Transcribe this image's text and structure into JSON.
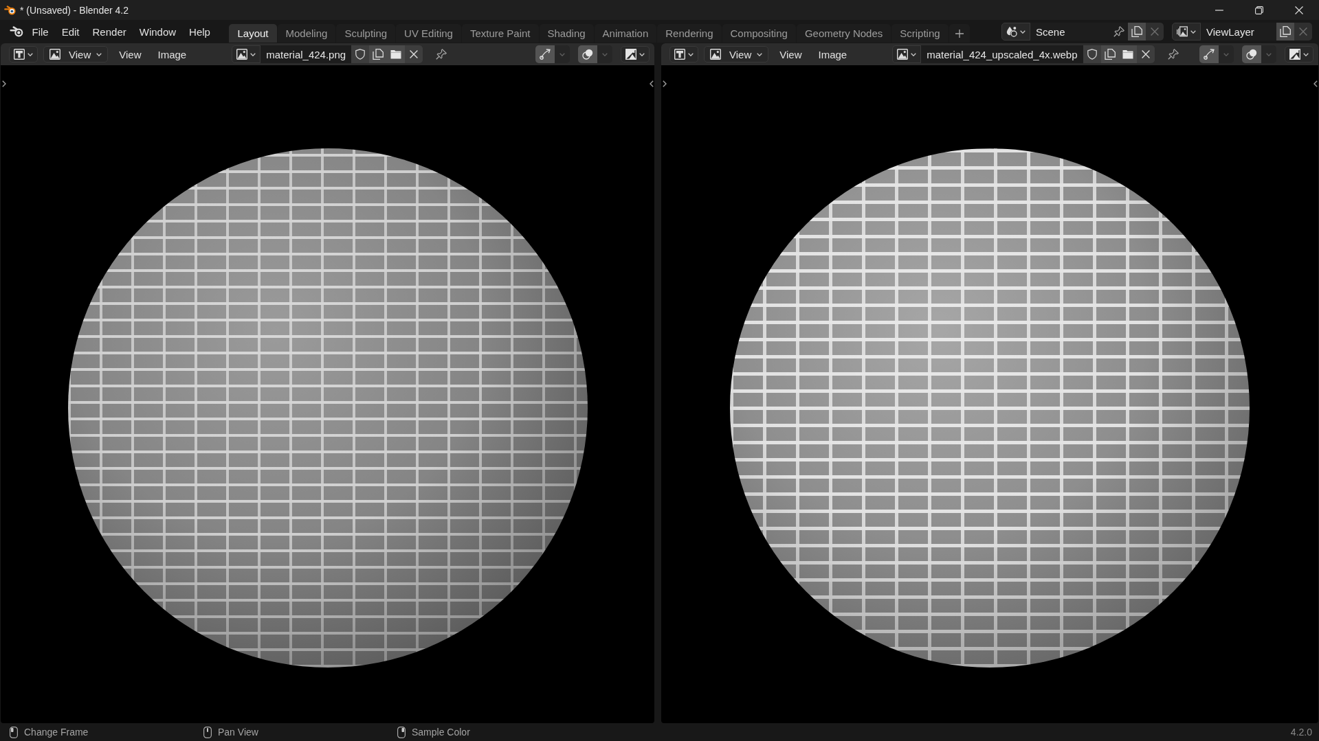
{
  "window": {
    "title": "* (Unsaved) - Blender 4.2"
  },
  "menu": [
    "File",
    "Edit",
    "Render",
    "Window",
    "Help"
  ],
  "workspaces": [
    {
      "label": "Layout",
      "selected": true
    },
    {
      "label": "Modeling",
      "selected": false
    },
    {
      "label": "Sculpting",
      "selected": false
    },
    {
      "label": "UV Editing",
      "selected": false
    },
    {
      "label": "Texture Paint",
      "selected": false
    },
    {
      "label": "Shading",
      "selected": false
    },
    {
      "label": "Animation",
      "selected": false
    },
    {
      "label": "Rendering",
      "selected": false
    },
    {
      "label": "Compositing",
      "selected": false
    },
    {
      "label": "Geometry Nodes",
      "selected": false
    },
    {
      "label": "Scripting",
      "selected": false
    }
  ],
  "scene": {
    "name": "Scene"
  },
  "view_layer": {
    "name": "ViewLayer"
  },
  "editors": [
    {
      "view_mode": "View",
      "menus": [
        "View",
        "Image"
      ],
      "image_name": "material_424.png",
      "gizmos": true,
      "overlays": true
    },
    {
      "view_mode": "View",
      "menus": [
        "View",
        "Image"
      ],
      "image_name": "material_424_upscaled_4x.webp",
      "gizmos": true,
      "overlays": true
    }
  ],
  "status_bar": {
    "hints": [
      {
        "kind": "left",
        "label": "Change Frame"
      },
      {
        "kind": "middle",
        "label": "Pan View"
      },
      {
        "kind": "right",
        "label": "Sample Color"
      }
    ],
    "version": "4.2.0"
  }
}
